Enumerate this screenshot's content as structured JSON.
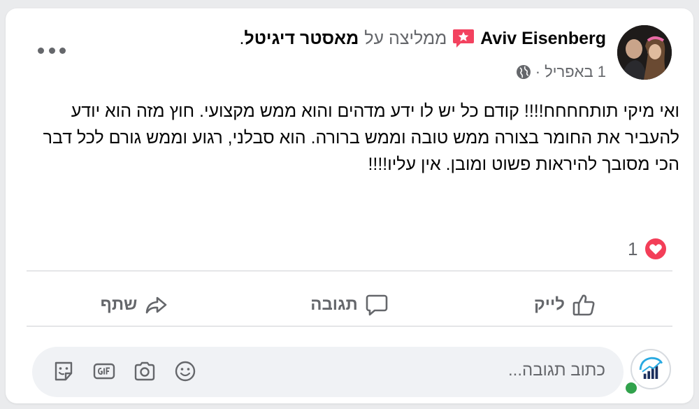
{
  "post": {
    "author_name": "Aviv Eisenberg",
    "recommends_text": "ממליצה על",
    "page_name": "מאסטר דיגיטל",
    "page_name_suffix": ".",
    "date": "1 באפריל",
    "meta_separator": "·",
    "body_text": "ואי מיקי תותחחחח!!!! קודם כל יש לו ידע מדהים והוא ממש מקצועי. חוץ מזה הוא יודע להעביר את החומר בצורה ממש טובה וממש ברורה. הוא סבלני, רגוע וממש גורם לכל דבר הכי מסובך להיראות פשוט ומובן. אין עליו!!!!",
    "reaction_count": "1"
  },
  "actions": {
    "like_label": "לייק",
    "comment_label": "תגובה",
    "share_label": "שתף"
  },
  "comment_box": {
    "placeholder": "כתוב תגובה..."
  },
  "icons": {
    "recommend": "recommend-star-icon",
    "privacy": "globe-icon",
    "reaction": "love-reaction-icon",
    "like": "thumbs-up-icon",
    "comment": "speech-bubble-icon",
    "share": "share-arrow-icon",
    "emoji": "smiley-icon",
    "camera": "camera-icon",
    "gif": "gif-icon",
    "sticker": "sticker-icon"
  },
  "colors": {
    "recommend_badge": "#f3425f",
    "love_reaction": "#f33e58",
    "online": "#31a24c",
    "text_secondary": "#65676b"
  }
}
